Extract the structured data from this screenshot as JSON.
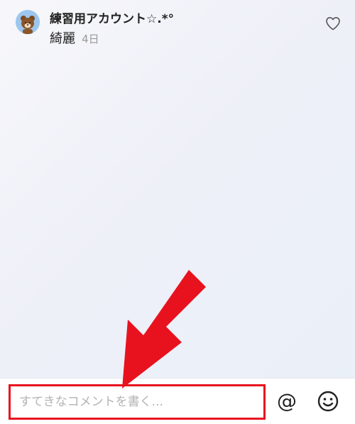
{
  "comment": {
    "username": "練習用アカウント☆.*°",
    "text": "綺麗",
    "time": "4日",
    "avatar_icon": "bear-avatar-icon",
    "like_icon": "heart-outline-icon"
  },
  "composer": {
    "placeholder": "すてきなコメントを書く...",
    "mention_label": "@",
    "emoji_icon": "smiley-face-icon"
  },
  "annotation": {
    "arrow_color": "#e8121e",
    "highlight_color": "#e8121e"
  }
}
